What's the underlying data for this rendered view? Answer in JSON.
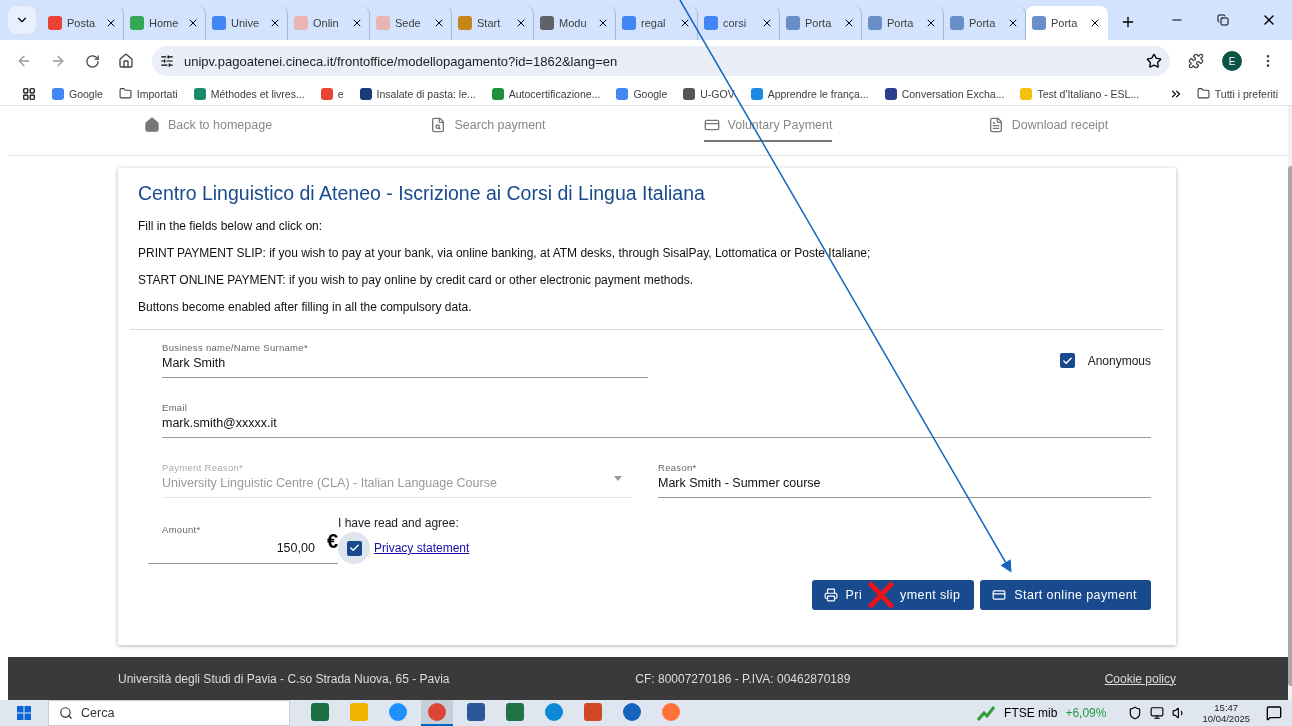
{
  "browser": {
    "tabs": [
      {
        "title": "Posta",
        "selected": false
      },
      {
        "title": "Home",
        "selected": false
      },
      {
        "title": "Unive",
        "selected": false
      },
      {
        "title": "Onlin",
        "selected": false
      },
      {
        "title": "Sede",
        "selected": false
      },
      {
        "title": "Start",
        "selected": false
      },
      {
        "title": "Modu",
        "selected": false
      },
      {
        "title": "regal",
        "selected": false
      },
      {
        "title": "corsi",
        "selected": false
      },
      {
        "title": "Porta",
        "selected": false
      },
      {
        "title": "Porta",
        "selected": false
      },
      {
        "title": "Porta",
        "selected": false
      },
      {
        "title": "Porta",
        "selected": true
      }
    ],
    "address": "unipv.pagoatenei.cineca.it/frontoffice/modellopagamento?id=1862&lang=en",
    "profile_initial": "E",
    "bookmarks": [
      "Google",
      "Importati",
      "Méthodes et livres...",
      "e",
      "Insalate di pasta: le...",
      "Autocertificazione...",
      "Google",
      "U-GOV",
      "Apprendre le frança...",
      "Conversation Excha...",
      "Test d'Italiano - ESL..."
    ],
    "all_bookmarks": "Tutti i preferiti"
  },
  "page": {
    "nav": [
      {
        "label": "Back to homepage",
        "selected": false
      },
      {
        "label": "Search payment",
        "selected": false
      },
      {
        "label": "Voluntary Payment",
        "selected": true
      },
      {
        "label": "Download receipt",
        "selected": false
      }
    ],
    "title": "Centro Linguistico di Ateneo - Iscrizione ai Corsi di Lingua Italiana",
    "paragraphs": [
      "Fill in the fields below and click on:",
      "PRINT PAYMENT SLIP: if you wish to pay at your bank, via online banking, at ATM desks, through SisalPay, Lottomatica or Poste Italiane;",
      "START ONLINE PAYMENT: if you wish to pay online by credit card or other electronic payment methods.",
      "Buttons become enabled after filling in all the compulsory data."
    ],
    "form": {
      "name": {
        "label": "Business name/Name Surname*",
        "value": "Mark Smith"
      },
      "anonymous": {
        "label": "Anonymous",
        "checked": true
      },
      "email": {
        "label": "Email",
        "value": "mark.smith@xxxxx.it"
      },
      "payment_reason": {
        "label": "Payment Reason*",
        "value": "University Linguistic Centre (CLA) - Italian Language Course",
        "disabled": true
      },
      "reason": {
        "label": "Reason*",
        "value": "Mark Smith - Summer course"
      },
      "amount": {
        "label": "Amount*",
        "value": "150,00",
        "currency": "€"
      },
      "privacy": {
        "prompt": "I have read and agree:",
        "link": "Privacy statement",
        "checked": true
      }
    },
    "buttons": [
      {
        "label_parts": [
          "Pri",
          "yment slip"
        ],
        "crossed": true
      },
      {
        "label_parts": [
          "Start online payment"
        ],
        "crossed": false
      }
    ]
  },
  "footer": {
    "address": "Università degli Studi di Pavia - C.so Strada Nuova, 65 - Pavia",
    "tax": "CF: 80007270186 - P.IVA: 00462870189",
    "cookie": "Cookie policy"
  },
  "taskbar": {
    "search_placeholder": "Cerca",
    "apps": [
      {
        "selected": false
      },
      {
        "selected": false
      },
      {
        "selected": false
      },
      {
        "selected": true
      },
      {
        "selected": false
      },
      {
        "selected": false
      },
      {
        "selected": false
      },
      {
        "selected": false
      },
      {
        "selected": false
      },
      {
        "selected": false
      }
    ],
    "ticker": {
      "name": "FTSE mib",
      "change": "+6,09%"
    },
    "time": "15:47",
    "date": "10/04/2025"
  }
}
